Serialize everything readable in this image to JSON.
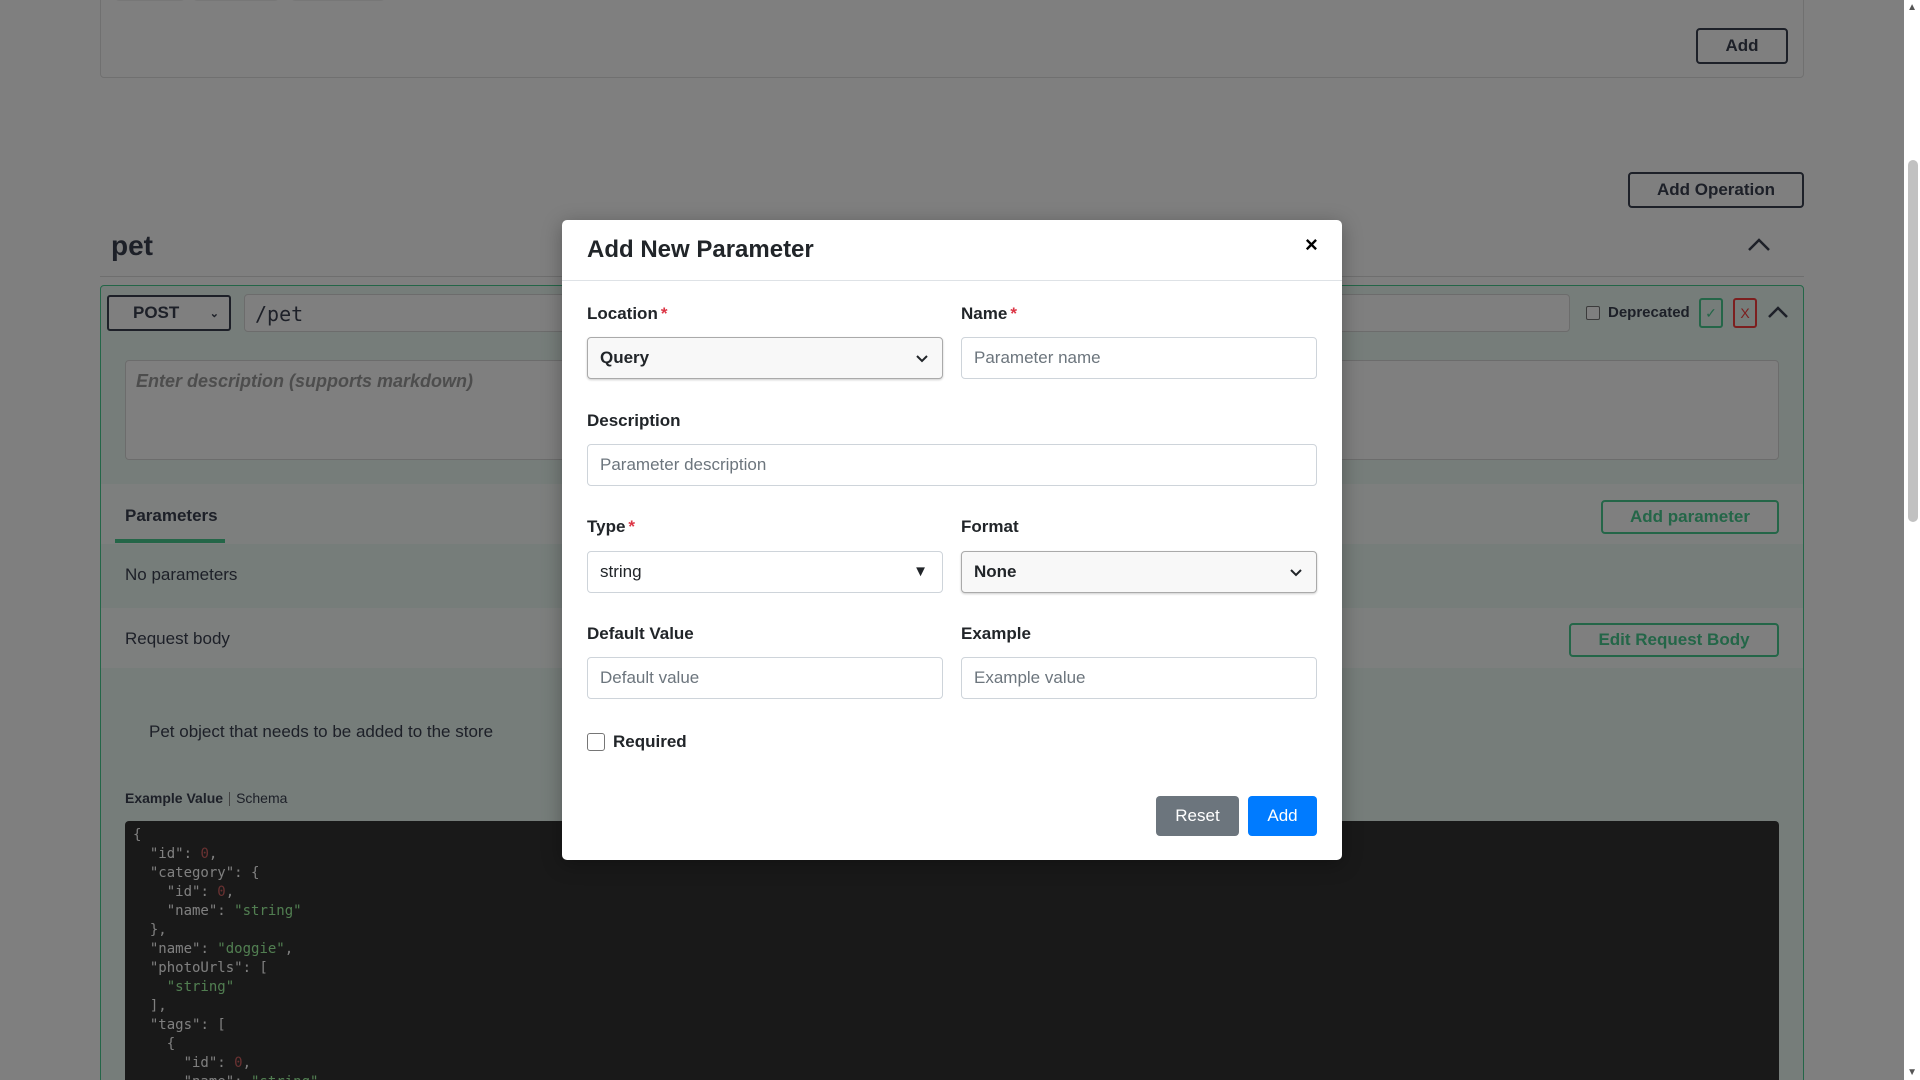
{
  "background": {
    "top_add_label": "Add",
    "add_operation_label": "Add Operation",
    "section_title": "pet",
    "operation": {
      "method": "POST",
      "path": "/pet",
      "deprecated_label": "Deprecated",
      "confirm_icon": "✓",
      "cancel_icon": "X",
      "description_placeholder": "Enter description (supports markdown)",
      "params_tab": "Parameters",
      "add_parameter_label": "Add parameter",
      "no_params": "No parameters",
      "request_body_label": "Request body",
      "edit_request_body_label": "Edit Request Body",
      "body_description": "Pet object that needs to be added to the store",
      "example_value_tab": "Example Value",
      "schema_tab": "Schema"
    }
  },
  "modal": {
    "title": "Add New Parameter",
    "close_icon": "×",
    "location_label": "Location",
    "location_value": "Query",
    "name_label": "Name",
    "name_placeholder": "Parameter name",
    "description_label": "Description",
    "description_placeholder": "Parameter description",
    "type_label": "Type",
    "type_value": "string",
    "format_label": "Format",
    "format_value": "None",
    "default_label": "Default Value",
    "default_placeholder": "Default value",
    "example_label": "Example",
    "example_placeholder": "Example value",
    "required_label": "Required",
    "reset_label": "Reset",
    "add_label": "Add"
  },
  "colors": {
    "accent_green": "#49cc90",
    "primary_blue": "#007bff",
    "secondary_gray": "#6c757d",
    "required_red": "#dc3545"
  }
}
